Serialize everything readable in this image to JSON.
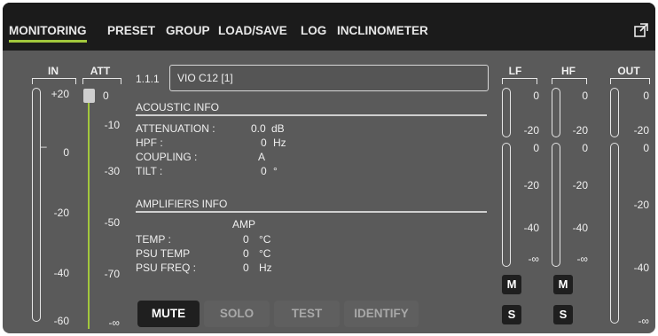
{
  "tabs": [
    {
      "label": "MONITORING"
    },
    {
      "label": "PRESET"
    },
    {
      "label": "GROUP"
    },
    {
      "label": "LOAD/SAVE"
    },
    {
      "label": "LOG"
    },
    {
      "label": "INCLINOMETER"
    }
  ],
  "active_tab": "MONITORING",
  "colors": {
    "accent": "#a2c73c",
    "panel": "#5a5a5a",
    "navbar": "#1b1b1b",
    "button_dark": "#1f1f1f"
  },
  "icons": {
    "expand": "expand-icon"
  },
  "in_meter": {
    "label": "IN",
    "ticks": [
      "+20",
      "0",
      "-20",
      "-40",
      "-60"
    ],
    "marker": "–"
  },
  "att_meter": {
    "label": "ATT",
    "ticks": [
      "0",
      "-10",
      "-30",
      "-50",
      "-70",
      "-∞"
    ],
    "level": 1.0
  },
  "device": {
    "id": "1.1.1",
    "name": "VIO C12  [1]"
  },
  "acoustic": {
    "title": "ACOUSTIC INFO",
    "rows": [
      {
        "label": "ATTENUATION :",
        "value": "0.0",
        "unit": "dB"
      },
      {
        "label": "HPF :",
        "value": "0",
        "unit": "Hz"
      },
      {
        "label": "COUPLING :",
        "value": "A",
        "unit": ""
      },
      {
        "label": "TILT :",
        "value": "0",
        "unit": "°"
      }
    ]
  },
  "amplifiers": {
    "title": "AMPLIFIERS INFO",
    "column": "AMP",
    "rows": [
      {
        "label": "TEMP :",
        "value": "0",
        "unit": "°C"
      },
      {
        "label": "PSU TEMP",
        "value": "0",
        "unit": "°C"
      },
      {
        "label": "PSU FREQ :",
        "value": "0",
        "unit": "Hz"
      }
    ]
  },
  "buttons": {
    "mute": "MUTE",
    "solo": "SOLO",
    "test": "TEST",
    "identify": "IDENTIFY"
  },
  "lf": {
    "label": "LF",
    "top_ticks": [
      "0",
      "-20"
    ],
    "ticks": [
      "0",
      "-20",
      "-40",
      "-∞"
    ]
  },
  "hf": {
    "label": "HF",
    "top_ticks": [
      "0",
      "-20"
    ],
    "ticks": [
      "0",
      "-20",
      "-40",
      "-∞"
    ]
  },
  "out": {
    "label": "OUT",
    "ticks": [
      "0",
      "-20",
      "0",
      "-20",
      "-40",
      "-∞"
    ]
  },
  "ms": {
    "m": "M",
    "s": "S"
  }
}
